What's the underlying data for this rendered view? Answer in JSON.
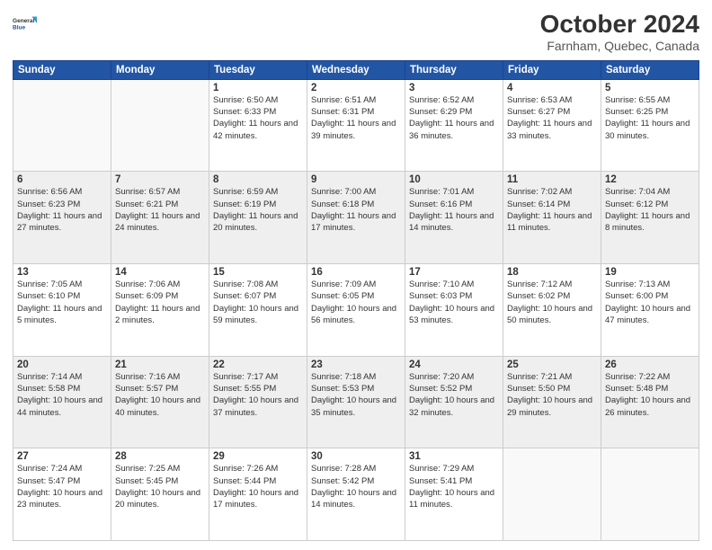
{
  "header": {
    "logo_line1": "General",
    "logo_line2": "Blue",
    "title": "October 2024",
    "subtitle": "Farnham, Quebec, Canada"
  },
  "days_of_week": [
    "Sunday",
    "Monday",
    "Tuesday",
    "Wednesday",
    "Thursday",
    "Friday",
    "Saturday"
  ],
  "weeks": [
    [
      {
        "day": "",
        "info": ""
      },
      {
        "day": "",
        "info": ""
      },
      {
        "day": "1",
        "info": "Sunrise: 6:50 AM\nSunset: 6:33 PM\nDaylight: 11 hours and 42 minutes."
      },
      {
        "day": "2",
        "info": "Sunrise: 6:51 AM\nSunset: 6:31 PM\nDaylight: 11 hours and 39 minutes."
      },
      {
        "day": "3",
        "info": "Sunrise: 6:52 AM\nSunset: 6:29 PM\nDaylight: 11 hours and 36 minutes."
      },
      {
        "day": "4",
        "info": "Sunrise: 6:53 AM\nSunset: 6:27 PM\nDaylight: 11 hours and 33 minutes."
      },
      {
        "day": "5",
        "info": "Sunrise: 6:55 AM\nSunset: 6:25 PM\nDaylight: 11 hours and 30 minutes."
      }
    ],
    [
      {
        "day": "6",
        "info": "Sunrise: 6:56 AM\nSunset: 6:23 PM\nDaylight: 11 hours and 27 minutes."
      },
      {
        "day": "7",
        "info": "Sunrise: 6:57 AM\nSunset: 6:21 PM\nDaylight: 11 hours and 24 minutes."
      },
      {
        "day": "8",
        "info": "Sunrise: 6:59 AM\nSunset: 6:19 PM\nDaylight: 11 hours and 20 minutes."
      },
      {
        "day": "9",
        "info": "Sunrise: 7:00 AM\nSunset: 6:18 PM\nDaylight: 11 hours and 17 minutes."
      },
      {
        "day": "10",
        "info": "Sunrise: 7:01 AM\nSunset: 6:16 PM\nDaylight: 11 hours and 14 minutes."
      },
      {
        "day": "11",
        "info": "Sunrise: 7:02 AM\nSunset: 6:14 PM\nDaylight: 11 hours and 11 minutes."
      },
      {
        "day": "12",
        "info": "Sunrise: 7:04 AM\nSunset: 6:12 PM\nDaylight: 11 hours and 8 minutes."
      }
    ],
    [
      {
        "day": "13",
        "info": "Sunrise: 7:05 AM\nSunset: 6:10 PM\nDaylight: 11 hours and 5 minutes."
      },
      {
        "day": "14",
        "info": "Sunrise: 7:06 AM\nSunset: 6:09 PM\nDaylight: 11 hours and 2 minutes."
      },
      {
        "day": "15",
        "info": "Sunrise: 7:08 AM\nSunset: 6:07 PM\nDaylight: 10 hours and 59 minutes."
      },
      {
        "day": "16",
        "info": "Sunrise: 7:09 AM\nSunset: 6:05 PM\nDaylight: 10 hours and 56 minutes."
      },
      {
        "day": "17",
        "info": "Sunrise: 7:10 AM\nSunset: 6:03 PM\nDaylight: 10 hours and 53 minutes."
      },
      {
        "day": "18",
        "info": "Sunrise: 7:12 AM\nSunset: 6:02 PM\nDaylight: 10 hours and 50 minutes."
      },
      {
        "day": "19",
        "info": "Sunrise: 7:13 AM\nSunset: 6:00 PM\nDaylight: 10 hours and 47 minutes."
      }
    ],
    [
      {
        "day": "20",
        "info": "Sunrise: 7:14 AM\nSunset: 5:58 PM\nDaylight: 10 hours and 44 minutes."
      },
      {
        "day": "21",
        "info": "Sunrise: 7:16 AM\nSunset: 5:57 PM\nDaylight: 10 hours and 40 minutes."
      },
      {
        "day": "22",
        "info": "Sunrise: 7:17 AM\nSunset: 5:55 PM\nDaylight: 10 hours and 37 minutes."
      },
      {
        "day": "23",
        "info": "Sunrise: 7:18 AM\nSunset: 5:53 PM\nDaylight: 10 hours and 35 minutes."
      },
      {
        "day": "24",
        "info": "Sunrise: 7:20 AM\nSunset: 5:52 PM\nDaylight: 10 hours and 32 minutes."
      },
      {
        "day": "25",
        "info": "Sunrise: 7:21 AM\nSunset: 5:50 PM\nDaylight: 10 hours and 29 minutes."
      },
      {
        "day": "26",
        "info": "Sunrise: 7:22 AM\nSunset: 5:48 PM\nDaylight: 10 hours and 26 minutes."
      }
    ],
    [
      {
        "day": "27",
        "info": "Sunrise: 7:24 AM\nSunset: 5:47 PM\nDaylight: 10 hours and 23 minutes."
      },
      {
        "day": "28",
        "info": "Sunrise: 7:25 AM\nSunset: 5:45 PM\nDaylight: 10 hours and 20 minutes."
      },
      {
        "day": "29",
        "info": "Sunrise: 7:26 AM\nSunset: 5:44 PM\nDaylight: 10 hours and 17 minutes."
      },
      {
        "day": "30",
        "info": "Sunrise: 7:28 AM\nSunset: 5:42 PM\nDaylight: 10 hours and 14 minutes."
      },
      {
        "day": "31",
        "info": "Sunrise: 7:29 AM\nSunset: 5:41 PM\nDaylight: 10 hours and 11 minutes."
      },
      {
        "day": "",
        "info": ""
      },
      {
        "day": "",
        "info": ""
      }
    ]
  ]
}
